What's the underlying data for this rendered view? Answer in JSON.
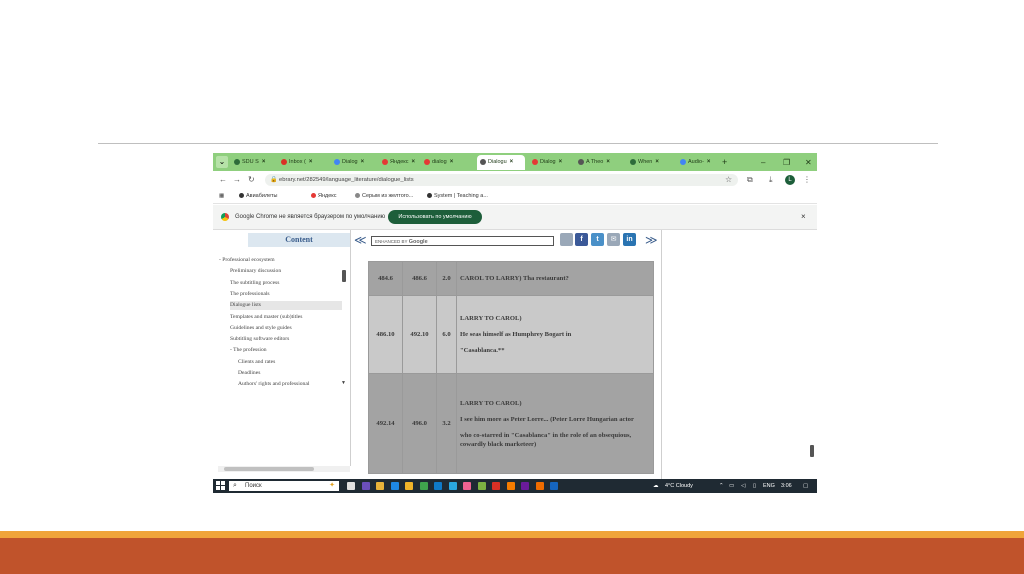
{
  "browser": {
    "menu_icon": "chevron-down-icon",
    "tabs": [
      {
        "label": "SDU S",
        "color": "#2d6b3a",
        "active": false
      },
      {
        "label": "Inbox (",
        "color": "#d93025",
        "active": false
      },
      {
        "label": "Dialog",
        "color": "#4285f4",
        "active": false
      },
      {
        "label": "Яндекс",
        "color": "#e53935",
        "active": false
      },
      {
        "label": "dialog",
        "color": "#e53935",
        "active": false
      },
      {
        "label": "Dialogu",
        "color": "#555555",
        "active": true
      },
      {
        "label": "Dialog",
        "color": "#e53935",
        "active": false
      },
      {
        "label": "A Theo",
        "color": "#555555",
        "active": false
      },
      {
        "label": "When",
        "color": "#2d6b3a",
        "active": false
      },
      {
        "label": "Audio-",
        "color": "#4285f4",
        "active": false
      }
    ],
    "tab_close_glyph": "×",
    "new_tab_glyph": "+",
    "window_controls": [
      "–",
      "❐",
      "✕"
    ],
    "address": {
      "url": "ebrary.net/282549/language_literature/dialogue_lists",
      "avatar_letter": "L"
    },
    "bookmarks": [
      {
        "label": "Авиабилеты",
        "color": "#333333"
      },
      {
        "label": "Яндекс",
        "color": "#e53935"
      },
      {
        "label": "Серым из желтого...",
        "color": "#888888"
      },
      {
        "label": "System | Teaching a...",
        "color": "#333333"
      }
    ],
    "infobar": {
      "text": "Google Chrome не является браузером по умолчанию",
      "button": "Использовать по умолчанию",
      "close": "×"
    }
  },
  "sidebar": {
    "title": "Content",
    "items": [
      {
        "label": "- Professional ecosystem",
        "indent": 0,
        "selected": false
      },
      {
        "label": "Preliminary discussion",
        "indent": 1,
        "selected": false
      },
      {
        "label": "The subtitling process",
        "indent": 1,
        "selected": false
      },
      {
        "label": "The professionals",
        "indent": 1,
        "selected": false
      },
      {
        "label": "Dialogue lists",
        "indent": 1,
        "selected": true
      },
      {
        "label": "Templates and master (sub)titles",
        "indent": 1,
        "selected": false
      },
      {
        "label": "Guidelines and style guides",
        "indent": 1,
        "selected": false
      },
      {
        "label": "Subtitling software editors",
        "indent": 1,
        "selected": false
      },
      {
        "label": "- The profession",
        "indent": 1,
        "selected": false
      },
      {
        "label": "Clients and rates",
        "indent": 2,
        "selected": false
      },
      {
        "label": "Deadlines",
        "indent": 2,
        "selected": false
      },
      {
        "label": "Authors' rights and professional",
        "indent": 2,
        "selected": false
      }
    ]
  },
  "main": {
    "prev_glyph": "≪",
    "next_glyph": "≫",
    "search": {
      "enhanced_by": "ENHANCED BY",
      "brand": "Google"
    },
    "social": [
      {
        "icon": "bookmark-icon",
        "label": "",
        "color": "#9aa8b8"
      },
      {
        "icon": "facebook-icon",
        "label": "f",
        "color": "#3b5998"
      },
      {
        "icon": "twitter-icon",
        "label": "t",
        "color": "#4a90c8"
      },
      {
        "icon": "email-icon",
        "label": "✉",
        "color": "#9aa8b8"
      },
      {
        "icon": "linkedin-icon",
        "label": "in",
        "color": "#2a74b2"
      }
    ],
    "table": [
      {
        "start": "484.6",
        "end": "486.6",
        "dur": "2.0",
        "lines": [
          "CAROL TO LARRY) Tha restaurant?"
        ],
        "shade": "dark",
        "h": 34
      },
      {
        "start": "486.10",
        "end": "492.10",
        "dur": "6.0",
        "lines": [
          "LARRY TO CAROL)",
          "He seas himself as Humphrey Bogart in",
          "\"Casablanca.**"
        ],
        "shade": "light",
        "h": 78
      },
      {
        "start": "492.14",
        "end": "496.0",
        "dur": "3.2",
        "lines": [
          "LARRY TO CAROL)",
          "I see him more as Peter Lorre... (Peter Lorre Hungarian actor",
          "who co-starred in \"Casablanca\" in the role of an obsequious, cowardly black marketeer)"
        ],
        "shade": "dark",
        "h": 100
      }
    ]
  },
  "taskbar": {
    "search_placeholder": "Поиск",
    "apps": [
      "#e0e0e0",
      "#6b4fbb",
      "#e8b33a",
      "#1e88e5",
      "#f0b429",
      "#3fa34d",
      "#0f7ac8",
      "#2aa8e0",
      "#f06292",
      "#7cb342",
      "#d93025",
      "#f57c00",
      "#6a1b9a",
      "#ef6c00",
      "#1565c0"
    ],
    "weather": "4°C Cloudy",
    "lang": "ENG",
    "time": "3:06"
  }
}
